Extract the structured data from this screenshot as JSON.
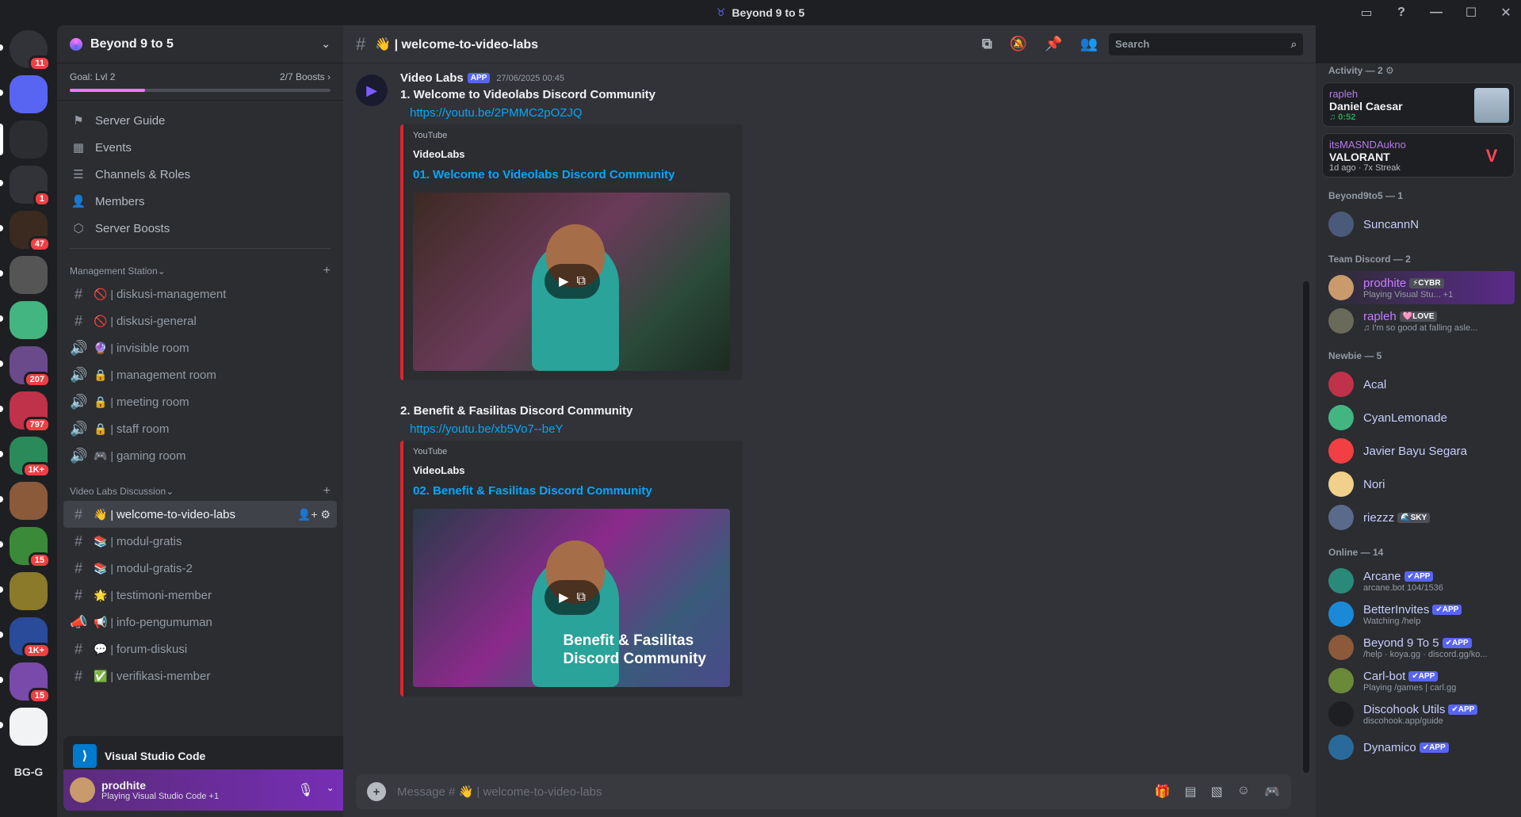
{
  "window": {
    "title": "Beyond 9 to 5"
  },
  "rail": {
    "servers": [
      {
        "name": "discord-home",
        "badge": "11",
        "color": "#313338"
      },
      {
        "name": "server-a",
        "badge": "",
        "color": "#5865f2"
      },
      {
        "name": "server-b",
        "badge": "",
        "color": "#2b2d31",
        "selected": true
      },
      {
        "name": "server-c",
        "badge": "1",
        "color": "#313338"
      },
      {
        "name": "server-d",
        "badge": "47",
        "color": "#3a2a20"
      },
      {
        "name": "server-e",
        "badge": "",
        "color": "#555"
      },
      {
        "name": "server-f",
        "badge": "",
        "color": "#43b581"
      },
      {
        "name": "server-g",
        "badge": "207",
        "color": "#6a4a8a"
      },
      {
        "name": "server-h",
        "badge": "797",
        "color": "#c0314a"
      },
      {
        "name": "server-i",
        "badge": "1K+",
        "color": "#2a8a5a"
      },
      {
        "name": "server-j",
        "badge": "",
        "color": "#8a5a3a"
      },
      {
        "name": "server-k",
        "badge": "15",
        "color": "#3a8a3a"
      },
      {
        "name": "server-l",
        "badge": "",
        "color": "#8a7a2a"
      },
      {
        "name": "server-m",
        "badge": "1K+",
        "color": "#2a4a9a"
      },
      {
        "name": "server-n",
        "badge": "15",
        "color": "#7a4aaa"
      },
      {
        "name": "server-o",
        "badge": "",
        "color": "#f2f3f5"
      }
    ],
    "folder_label": "BG-G"
  },
  "sidebar": {
    "guild_name": "Beyond 9 to 5",
    "goal_label": "Goal: Lvl 2",
    "boosts": "2/7 Boosts",
    "goal_progress": 0.29,
    "menu": [
      "Server Guide",
      "Events",
      "Channels & Roles",
      "Members",
      "Server Boosts"
    ],
    "categories": [
      {
        "name": "Management Station",
        "channels": [
          {
            "icon": "🚫",
            "label": "diskusi-management",
            "type": "text"
          },
          {
            "icon": "🚫",
            "label": "diskusi-general",
            "type": "text"
          },
          {
            "icon": "🔮",
            "label": "invisible room",
            "type": "voice"
          },
          {
            "icon": "🔒",
            "label": "management room",
            "type": "voice"
          },
          {
            "icon": "🔒",
            "label": "meeting room",
            "type": "voice"
          },
          {
            "icon": "🔒",
            "label": "staff room",
            "type": "voice"
          },
          {
            "icon": "🎮",
            "label": "gaming room",
            "type": "voice"
          }
        ]
      },
      {
        "name": "Video Labs Discussion",
        "channels": [
          {
            "icon": "👋",
            "label": "welcome-to-video-labs",
            "type": "text",
            "selected": true
          },
          {
            "icon": "📚",
            "label": "modul-gratis",
            "type": "text"
          },
          {
            "icon": "📚",
            "label": "modul-gratis-2",
            "type": "text"
          },
          {
            "icon": "🌟",
            "label": "testimoni-member",
            "type": "text"
          },
          {
            "icon": "📢",
            "label": "info-pengumuman",
            "type": "announce"
          },
          {
            "icon": "💬",
            "label": "forum-diskusi",
            "type": "text"
          },
          {
            "icon": "✅",
            "label": "verifikasi-member",
            "type": "text"
          }
        ]
      }
    ],
    "activity_app": "Visual Studio Code",
    "user": {
      "name": "prodhite",
      "status": "Playing Visual Studio Code +1"
    }
  },
  "channel": {
    "name": "👋 | welcome-to-video-labs",
    "search_placeholder": "Search",
    "input_placeholder": "Message # 👋 | welcome-to-video-labs"
  },
  "message": {
    "author": "Video Labs",
    "app_tag": "APP",
    "timestamp": "27/06/2025 00:45",
    "items": [
      {
        "heading": "1. Welcome to Videolabs Discord Community",
        "link": "https://youtu.be/2PMMC2pOZJQ",
        "provider": "YouTube",
        "embed_author": "VideoLabs",
        "embed_title": "01. Welcome to Videolabs Discord Community",
        "caption": ""
      },
      {
        "heading": "2. Benefit & Fasilitas Discord Community",
        "link": "https://youtu.be/xb5Vo7--beY",
        "provider": "YouTube",
        "embed_author": "VideoLabs",
        "embed_title": "02. Benefit & Fasilitas Discord Community",
        "caption": "Benefit & Fasilitas\nDiscord Community"
      }
    ]
  },
  "members": {
    "activity_header": "Activity — 2",
    "activities": [
      {
        "user": "rapleh",
        "title": "Daniel Caesar",
        "sub": "♫ 0:52",
        "thumb": "album"
      },
      {
        "user": "itsMASNDAukno",
        "title": "VALORANT",
        "sub": "1d ago · 7x Streak",
        "thumb": "V"
      }
    ],
    "groups": [
      {
        "name": "Beyond9to5 — 1",
        "members": [
          {
            "name": "SuncannN",
            "sub": "",
            "tag": "",
            "color": "#4a5a7a"
          }
        ]
      },
      {
        "name": "Team Discord — 2",
        "members": [
          {
            "name": "prodhite",
            "sub": "Playing Visual Stu... +1",
            "tag": "⚡CYBR",
            "color": "#c99a6b",
            "purple": true,
            "hl": true
          },
          {
            "name": "rapleh",
            "sub": "♫ I'm so good at falling asle...",
            "tag": "🩷LOVE",
            "color": "#6a6a5a",
            "purple": true
          }
        ]
      },
      {
        "name": "Newbie — 5",
        "members": [
          {
            "name": "Acal",
            "sub": "",
            "tag": "",
            "color": "#c0314a"
          },
          {
            "name": "CyanLemonade",
            "sub": "",
            "tag": "",
            "color": "#43b581"
          },
          {
            "name": "Javier Bayu Segara",
            "sub": "",
            "tag": "",
            "color": "#f23f43"
          },
          {
            "name": "Nori",
            "sub": "",
            "tag": "",
            "color": "#f0d08a"
          },
          {
            "name": "riezzz",
            "sub": "",
            "tag": "🌊SKY",
            "color": "#5a6a8a"
          }
        ]
      },
      {
        "name": "Online — 14",
        "members": [
          {
            "name": "Arcane",
            "sub": "arcane.bot 104/1536",
            "tag": "✔APP",
            "color": "#2a8a7a",
            "app": true
          },
          {
            "name": "BetterInvites",
            "sub": "Watching /help",
            "tag": "✔APP",
            "color": "#1a8ad8",
            "app": true
          },
          {
            "name": "Beyond 9 To 5",
            "sub": "/help · koya.gg · discord.gg/ko...",
            "tag": "✔APP",
            "color": "#8a5a3a",
            "app": true
          },
          {
            "name": "Carl-bot",
            "sub": "Playing /games | carl.gg",
            "tag": "✔APP",
            "color": "#6a8a3a",
            "app": true
          },
          {
            "name": "Discohook Utils",
            "sub": "discohook.app/guide",
            "tag": "✔APP",
            "color": "#1e1f22",
            "app": true
          },
          {
            "name": "Dynamico",
            "sub": "",
            "tag": "✔APP",
            "color": "#2a6a9a",
            "app": true
          }
        ]
      }
    ]
  }
}
